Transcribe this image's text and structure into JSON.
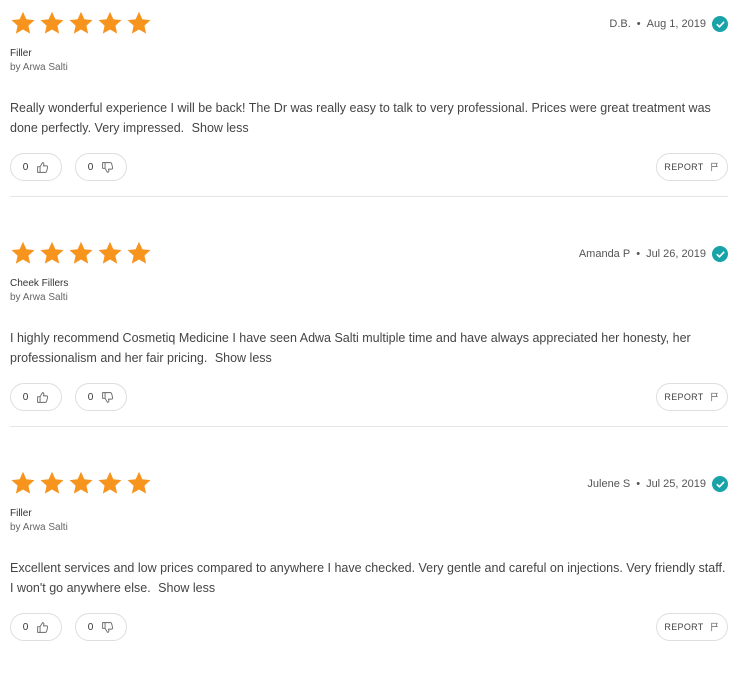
{
  "colors": {
    "star": "#f7941d",
    "verified": "#19a3a8"
  },
  "reviews": [
    {
      "rating": 5,
      "reviewer": "D.B.",
      "date": "Aug 1, 2019",
      "service": "Filler",
      "by": "by Arwa Salti",
      "text": "Really wonderful experience I will be back! The Dr was really easy to talk to very professional. Prices were great treatment was done perfectly. Very impressed.",
      "show_less": "Show less",
      "upvotes": "0",
      "downvotes": "0",
      "report": "REPORT"
    },
    {
      "rating": 5,
      "reviewer": "Amanda P",
      "date": "Jul 26, 2019",
      "service": "Cheek Fillers",
      "by": "by Arwa Salti",
      "text": "I highly recommend Cosmetiq Medicine I have seen Adwa Salti multiple time and have always appreciated her honesty, her professionalism and her fair pricing.",
      "show_less": "Show less",
      "upvotes": "0",
      "downvotes": "0",
      "report": "REPORT"
    },
    {
      "rating": 5,
      "reviewer": "Julene S",
      "date": "Jul 25, 2019",
      "service": "Filler",
      "by": "by Arwa Salti",
      "text": "Excellent services and low prices compared to anywhere I have checked. Very gentle and careful on injections. Very friendly staff. I won't go anywhere else.",
      "show_less": "Show less",
      "upvotes": "0",
      "downvotes": "0",
      "report": "REPORT"
    }
  ]
}
